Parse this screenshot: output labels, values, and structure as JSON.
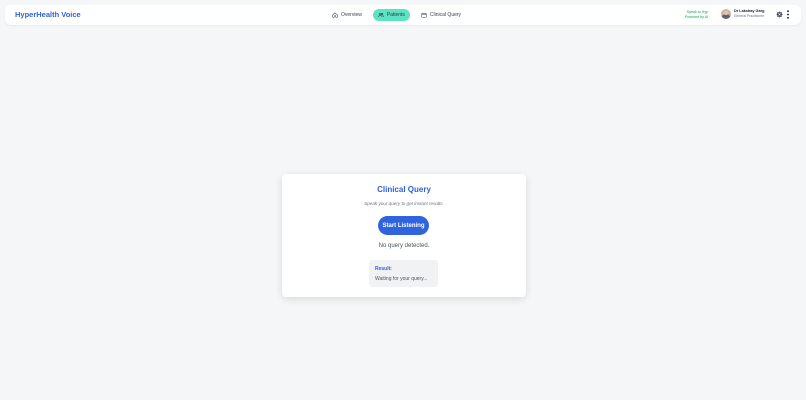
{
  "app": {
    "title": "HyperHealth Voice"
  },
  "nav": [
    {
      "label": "Overview",
      "icon": "home-icon",
      "active": false
    },
    {
      "label": "Patients",
      "icon": "users-icon",
      "active": true
    },
    {
      "label": "Clinical Query",
      "icon": "calendar-icon",
      "active": false
    }
  ],
  "header": {
    "speak_line1": "Speak to Hyp",
    "speak_line2": "Powered by AI",
    "user_name": "Dr Lakshay Garg",
    "user_role": "General Practitioner",
    "settings_icon": "gear-icon",
    "menu_icon": "more-vertical-icon"
  },
  "query_card": {
    "title": "Clinical Query",
    "subtitle": "Speak your query to get instant results.",
    "button_label": "Start Listening",
    "status": "No query detected.",
    "result_label": "Result:",
    "result_text": "Waiting for your query..."
  },
  "colors": {
    "brand": "#2f5fd8",
    "active_tab": "#5ee3c2",
    "button": "#2f64de",
    "speak_note": "#16a34a"
  }
}
